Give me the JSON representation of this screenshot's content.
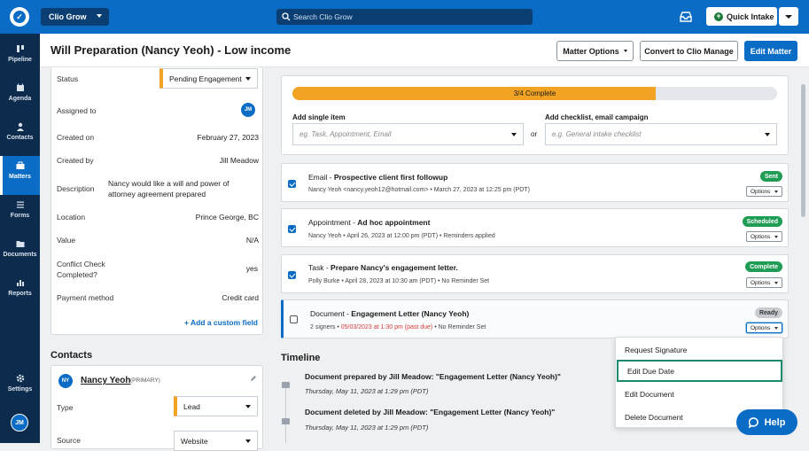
{
  "topbar": {
    "app_switch_label": "Clio Grow",
    "search_placeholder": "Search Clio Grow",
    "quick_intake_label": "Quick Intake"
  },
  "sidebar": {
    "items": [
      {
        "label": "Pipeline",
        "icon": "pipeline-icon"
      },
      {
        "label": "Agenda",
        "icon": "calendar-icon"
      },
      {
        "label": "Contacts",
        "icon": "person-icon"
      },
      {
        "label": "Matters",
        "icon": "briefcase-icon"
      },
      {
        "label": "Forms",
        "icon": "list-icon"
      },
      {
        "label": "Documents",
        "icon": "folder-icon"
      },
      {
        "label": "Reports",
        "icon": "bar-chart-icon"
      }
    ],
    "settings_label": "Settings",
    "user_initials": "JM"
  },
  "header": {
    "title": "Will Preparation (Nancy Yeoh) - Low income",
    "matter_options_label": "Matter Options",
    "convert_label": "Convert to Clio Manage",
    "edit_label": "Edit Matter"
  },
  "details": {
    "status_label": "Status",
    "status_value": "Pending Engagement",
    "assigned_label": "Assigned to",
    "assigned_initials": "JM",
    "created_on_label": "Created on",
    "created_on_value": "February 27, 2023",
    "created_by_label": "Created by",
    "created_by_value": "Jill Meadow",
    "description_label": "Description",
    "description_value_1": "Nancy would like a will and power of",
    "description_value_2": "attorney agreement prepared",
    "location_label": "Location",
    "location_value": "Prince George, BC",
    "value_label": "Value",
    "value_value": "N/A",
    "conflict_label_1": "Conflict Check",
    "conflict_label_2": "Completed?",
    "conflict_value": "yes",
    "payment_label": "Payment method",
    "payment_value": "Credit card",
    "add_field_label": "+ Add a custom field"
  },
  "contacts": {
    "heading": "Contacts",
    "initials": "NY",
    "name": "Nancy Yeoh",
    "tag": "(PRIMARY)",
    "type_label": "Type",
    "type_value": "Lead",
    "source_label": "Source",
    "source_value": "Website"
  },
  "progress": {
    "label": "3/4 Complete",
    "fraction": 0.75
  },
  "add_item": {
    "single_label": "Add single item",
    "single_placeholder": "eg. Task, Appointment, Email",
    "or_label": "or",
    "checklist_label": "Add checklist, email campaign",
    "checklist_placeholder": "e.g. General intake checklist"
  },
  "tasks": [
    {
      "type": "Email - ",
      "title": "Prospective client first followup",
      "sub_1": "Nancy Yeoh <nancy.yeoh12@hotmail.com> • March 27, 2023 at 12:25 pm (PDT)",
      "sub_2": "",
      "sub_3": "",
      "badge": "Sent",
      "badge_color": "#1f9d55",
      "checked": true,
      "options": "Options"
    },
    {
      "type": "Appointment - ",
      "title": "Ad hoc appointment",
      "sub_1": "Nancy Yeoh • April 26, 2023 at 12:00 pm (PDT) • Reminders applied",
      "sub_2": "",
      "sub_3": "",
      "badge": "Scheduled",
      "badge_color": "#1f9d55",
      "checked": true,
      "options": "Options"
    },
    {
      "type": "Task - ",
      "title": "Prepare Nancy's engagement letter.",
      "sub_1": "Polly Burke • April 28, 2023 at 10:30 am (PDT) • No Reminder Set",
      "sub_2": "",
      "sub_3": "",
      "badge": "Complete",
      "badge_color": "#1f9d55",
      "checked": true,
      "options": "Options"
    },
    {
      "type": "Document - ",
      "title": "Engagement Letter (Nancy Yeoh)",
      "sub_1": "2 signers • ",
      "sub_2": "05/03/2023 at 1:30 pm (past due)",
      "sub_3": " • No Reminder Set",
      "badge": "Ready",
      "badge_color": "#c8ccd1",
      "checked": false,
      "options": "Options"
    }
  ],
  "options_menu": {
    "items": [
      "Request Signature",
      "Edit Due Date",
      "Edit Document",
      "Delete Document"
    ]
  },
  "timeline": {
    "heading": "Timeline",
    "entries": [
      {
        "text": "Document prepared by Jill Meadow: \"Engagement Letter (Nancy Yeoh)\"",
        "date": "Thursday, May 11, 2023 at 1:29 pm (PDT)"
      },
      {
        "text": "Document deleted by Jill Meadow: \"Engagement Letter (Nancy Yeoh)\"",
        "date": "Thursday, May 11, 2023 at 1:29 pm (PDT)"
      }
    ]
  },
  "help_label": "Help",
  "colors": {
    "brand_blue": "#0a6cc5",
    "sidebar_navy": "#0c2b4d",
    "progress_orange": "#f2a324",
    "success_green": "#1f9d55",
    "past_due_red": "#d83a3a",
    "highlight_teal": "#1a8a6c"
  }
}
